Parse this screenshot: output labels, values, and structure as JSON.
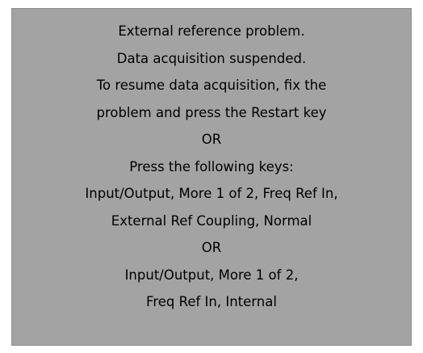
{
  "dialog": {
    "colors": {
      "background": "#a3a3a3",
      "text": "#000000"
    },
    "lines": [
      "External reference problem.",
      "Data acquisition suspended.",
      "To resume data acquisition, fix the",
      "problem and press the Restart key",
      "OR",
      "Press the following keys:",
      "Input/Output, More 1 of 2, Freq Ref In,",
      "External Ref Coupling, Normal",
      "OR",
      "Input/Output,  More 1 of 2,",
      "Freq Ref In, Internal"
    ]
  }
}
